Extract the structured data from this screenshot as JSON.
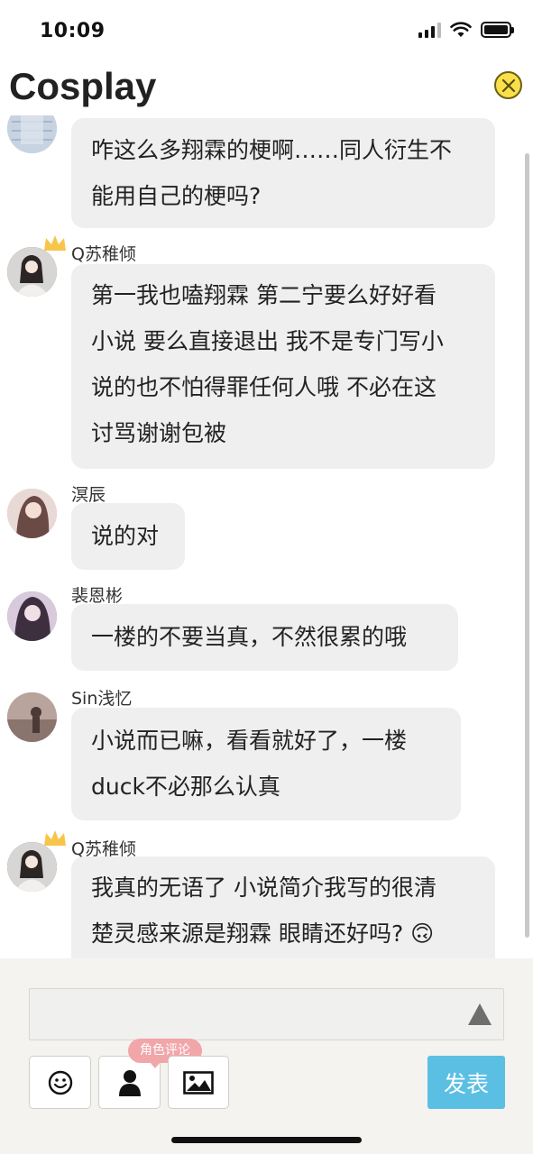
{
  "status_bar": {
    "time": "10:09"
  },
  "header": {
    "title": "Cosplay"
  },
  "messages": [
    {
      "nickname": "",
      "lines": [
        "咋这么多翔霖的梗啊……同人衍生不",
        "能用自己的梗吗?"
      ],
      "crown": false,
      "avatar_color": "#b9c7d9"
    },
    {
      "nickname": "Q苏稚倾",
      "lines": [
        "第一我也嗑翔霖 第二宁要么好好看",
        "小说 要么直接退出 我不是专门写小",
        "说的也不怕得罪任何人哦 不必在这",
        "讨骂谢谢包被"
      ],
      "crown": true,
      "avatar_color": "#5b5554"
    },
    {
      "nickname": "溟辰",
      "lines": [
        "说的对"
      ],
      "crown": false,
      "avatar_color": "#c9a6a3"
    },
    {
      "nickname": "裴恩彬",
      "lines": [
        "一楼的不要当真，不然很累的哦"
      ],
      "crown": false,
      "avatar_color": "#9c8a9f"
    },
    {
      "nickname": "Sin浅忆",
      "lines": [
        "小说而已嘛，看看就好了，一楼",
        "duck不必那么认真"
      ],
      "crown": false,
      "avatar_color": "#a68e87"
    },
    {
      "nickname": "Q苏稚倾",
      "lines": [
        "我真的无语了 小说简介我写的很清",
        "楚灵感来源是翔霖 眼睛还好吗? 🙃"
      ],
      "crown": true,
      "avatar_color": "#5b5554"
    }
  ],
  "composer": {
    "role_badge": "角色评论",
    "send_label": "发表"
  },
  "colors": {
    "bubble": "#efefef",
    "send_button": "#5bbfe4",
    "role_badge": "#f1a6aa",
    "close_button": "#f9e04b"
  }
}
